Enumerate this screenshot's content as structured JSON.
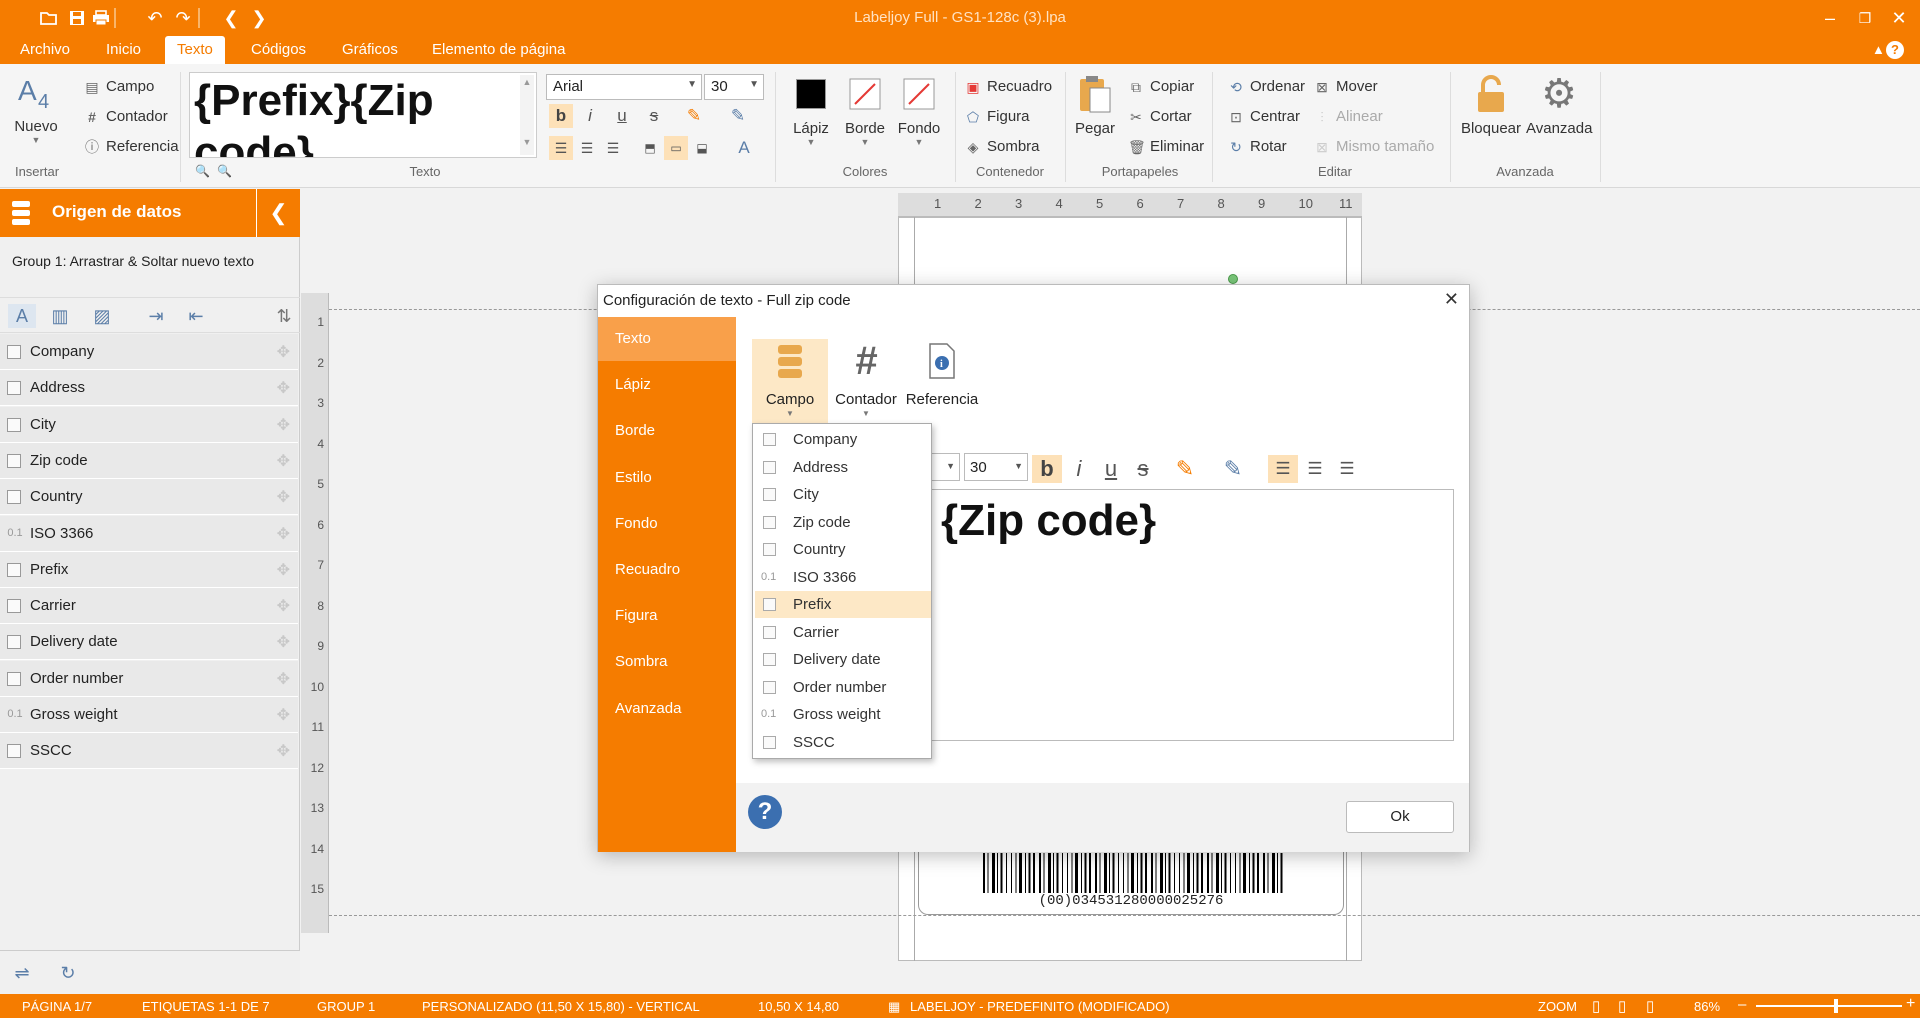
{
  "window": {
    "title": "Labeljoy Full - GS1-128c (3).lpa"
  },
  "menu": [
    "Archivo",
    "Inicio",
    "Texto",
    "Códigos",
    "Gráficos",
    "Elemento de página"
  ],
  "ribbon": {
    "insertar": {
      "nuevo": "Nuevo",
      "campo": "Campo",
      "contador": "Contador",
      "referencia": "Referencia",
      "label": "Insertar"
    },
    "texto": {
      "preview": "{Prefix}{Zip code}",
      "font": "Arial",
      "size": "30",
      "label": "Texto"
    },
    "colores": {
      "lapiz": "Lápiz",
      "borde": "Borde",
      "fondo": "Fondo",
      "label": "Colores"
    },
    "contenedor": {
      "recuadro": "Recuadro",
      "figura": "Figura",
      "sombra": "Sombra",
      "label": "Contenedor"
    },
    "portapapeles": {
      "pegar": "Pegar",
      "copiar": "Copiar",
      "cortar": "Cortar",
      "eliminar": "Eliminar",
      "label": "Portapapeles"
    },
    "editar": {
      "ordenar": "Ordenar",
      "centrar": "Centrar",
      "rotar": "Rotar",
      "mover": "Mover",
      "alinear": "Alinear",
      "mismo": "Mismo tamaño",
      "label": "Editar"
    },
    "avanzada": {
      "bloquear": "Bloquear",
      "avanzada": "Avanzada",
      "label": "Avanzada"
    }
  },
  "leftpanel": {
    "title": "Origen de datos",
    "group": "Group 1: Arrastrar & Soltar nuevo texto",
    "fields": [
      {
        "name": "Company",
        "type": "text"
      },
      {
        "name": "Address",
        "type": "text"
      },
      {
        "name": "City",
        "type": "text"
      },
      {
        "name": "Zip code",
        "type": "text"
      },
      {
        "name": "Country",
        "type": "text"
      },
      {
        "name": "ISO 3366",
        "type": "number"
      },
      {
        "name": "Prefix",
        "type": "text"
      },
      {
        "name": "Carrier",
        "type": "text"
      },
      {
        "name": "Delivery date",
        "type": "date"
      },
      {
        "name": "Order number",
        "type": "text"
      },
      {
        "name": "Gross weight",
        "type": "number"
      },
      {
        "name": "SSCC",
        "type": "text"
      }
    ]
  },
  "ruler_top": [
    "1",
    "2",
    "3",
    "4",
    "5",
    "6",
    "7",
    "8",
    "9",
    "10",
    "11"
  ],
  "ruler_left": [
    "1",
    "2",
    "3",
    "4",
    "5",
    "6",
    "7",
    "8",
    "9",
    "10",
    "11",
    "12",
    "13",
    "14",
    "15"
  ],
  "label": {
    "barcode_text": "(00)034531280000025276"
  },
  "dialog": {
    "title": "Configuración de texto - Full zip code",
    "side": [
      "Texto",
      "Lápiz",
      "Borde",
      "Estilo",
      "Fondo",
      "Recuadro",
      "Figura",
      "Sombra",
      "Avanzada"
    ],
    "tools": {
      "campo": "Campo",
      "contador": "Contador",
      "referencia": "Referencia"
    },
    "size": "30",
    "editor_text": "{Zip code}",
    "dropdown": [
      {
        "name": "Company",
        "type": "text"
      },
      {
        "name": "Address",
        "type": "text"
      },
      {
        "name": "City",
        "type": "text"
      },
      {
        "name": "Zip code",
        "type": "text"
      },
      {
        "name": "Country",
        "type": "text"
      },
      {
        "name": "ISO 3366",
        "type": "number"
      },
      {
        "name": "Prefix",
        "type": "text"
      },
      {
        "name": "Carrier",
        "type": "text"
      },
      {
        "name": "Delivery date",
        "type": "date"
      },
      {
        "name": "Order number",
        "type": "text"
      },
      {
        "name": "Gross weight",
        "type": "number"
      },
      {
        "name": "SSCC",
        "type": "text"
      }
    ],
    "highlighted": "Prefix",
    "ok": "Ok"
  },
  "status": {
    "pagina": "PÁGINA 1/7",
    "etiquetas": "ETIQUETAS 1-1 DE 7",
    "group": "GROUP 1",
    "personalizado": "PERSONALIZADO (11,50 X 15,80) - VERTICAL",
    "size": "10,50 X 14,80",
    "labeljoy": "LABELJOY - PREDEFINITO (MODIFICADO)",
    "zoom_label": "ZOOM",
    "zoom": "86%",
    "zoom_value": 0.86
  },
  "colors": {
    "accent": "#f57c00",
    "accent_light": "#f9a04a",
    "highlight": "#fde8c6"
  }
}
